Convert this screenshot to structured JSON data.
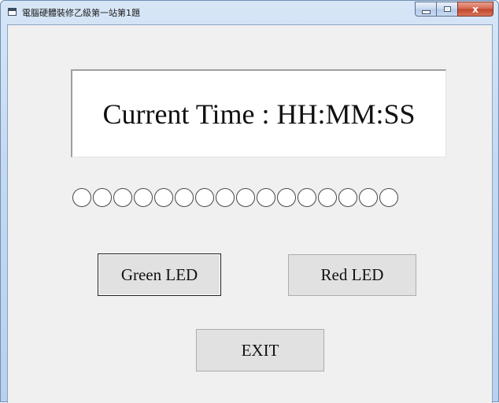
{
  "window": {
    "title": "電腦硬體裝修乙級第一站第1題",
    "controls": {
      "minimize_icon": "minimize-icon",
      "maximize_icon": "maximize-icon",
      "close_glyph": "x"
    }
  },
  "display": {
    "time_text": "Current Time : HH:MM:SS"
  },
  "leds": {
    "count": 16,
    "states": [
      "off",
      "off",
      "off",
      "off",
      "off",
      "off",
      "off",
      "off",
      "off",
      "off",
      "off",
      "off",
      "off",
      "off",
      "off",
      "off"
    ]
  },
  "buttons": {
    "green_label": "Green LED",
    "red_label": "Red LED",
    "exit_label": "EXIT"
  },
  "colors": {
    "led_off": "#ffffff",
    "led_green": "#00c000",
    "led_red": "#e00000"
  }
}
